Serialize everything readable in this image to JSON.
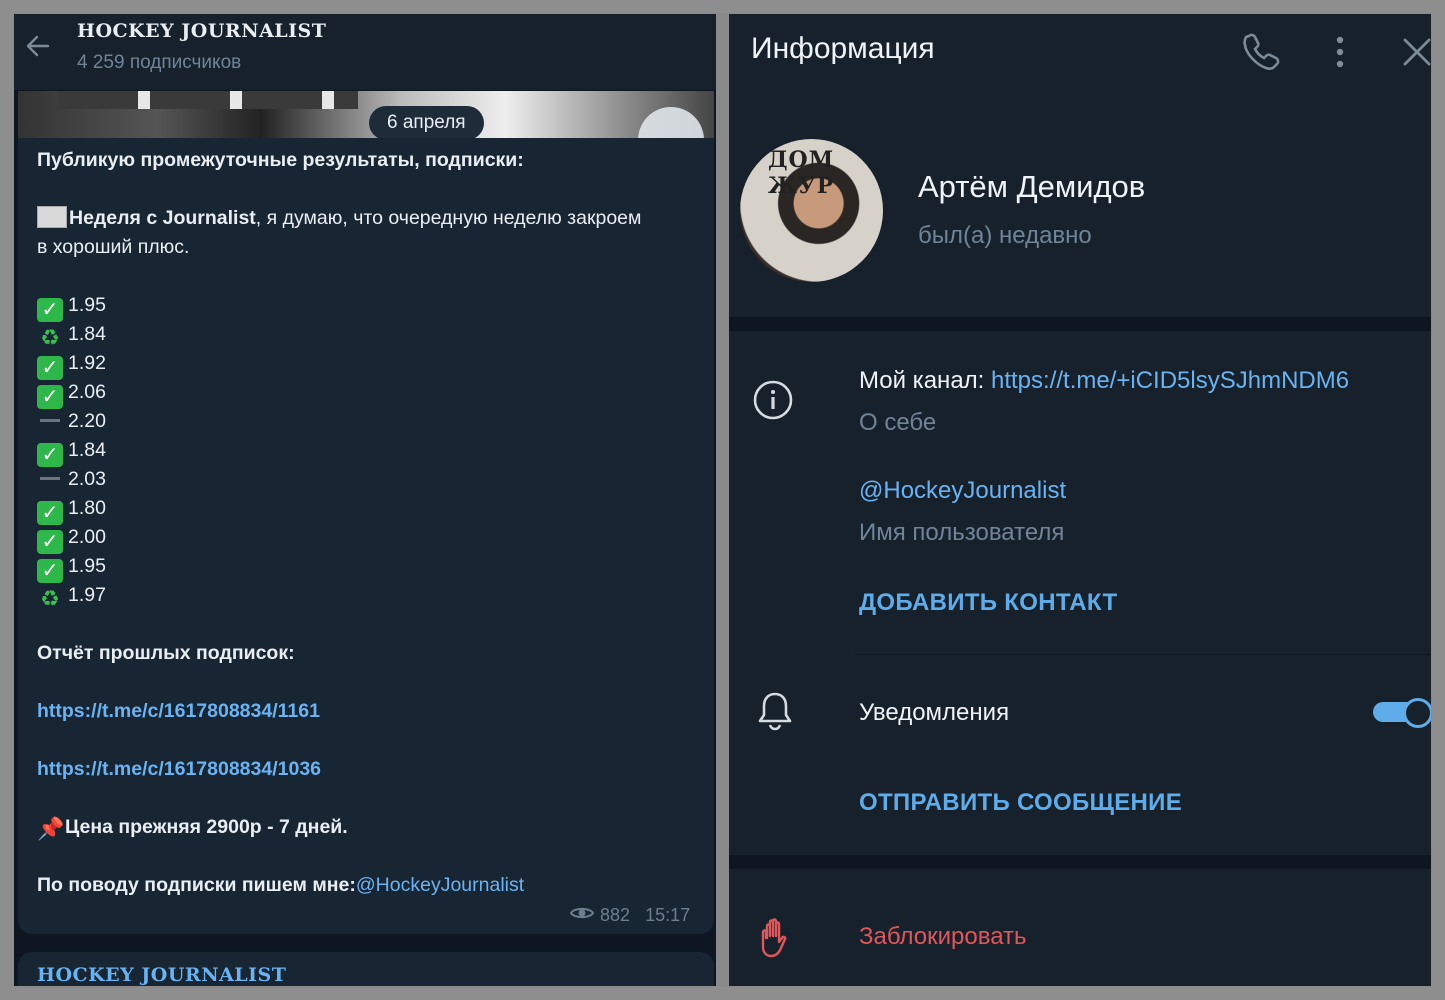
{
  "left_panel": {
    "header": {
      "channel_title": "HOCKEY JOURNALIST",
      "subscribers": "4 259 подписчиков"
    },
    "date_pill": "6 апреля",
    "message": {
      "intro": "Публикую промежуточные результаты, подписки:",
      "week_bold": "Неделя с Journalist",
      "week_rest": ", я думаю, что очередную неделю закроем",
      "week_rest2": "в хороший плюс.",
      "results": [
        {
          "icon": "check",
          "value": "1.95"
        },
        {
          "icon": "recycle",
          "value": "1.84"
        },
        {
          "icon": "check",
          "value": "1.92"
        },
        {
          "icon": "check",
          "value": "2.06"
        },
        {
          "icon": "dash",
          "value": "2.20"
        },
        {
          "icon": "check",
          "value": "1.84"
        },
        {
          "icon": "dash",
          "value": "2.03"
        },
        {
          "icon": "check",
          "value": "1.80"
        },
        {
          "icon": "check",
          "value": "2.00"
        },
        {
          "icon": "check",
          "value": "1.95"
        },
        {
          "icon": "recycle",
          "value": "1.97"
        }
      ],
      "report_label": "Отчёт прошлых подписок:",
      "link1": "https://t.me/c/1617808834/1161",
      "link2": "https://t.me/c/1617808834/1036",
      "price": "Цена прежняя 2900р - 7 дней.",
      "contact_prefix": "По поводу подписки пишем мне:",
      "contact_handle": "@HockeyJournalist",
      "views": "882",
      "time": "15:17"
    },
    "next_message_title": "HOCKEY JOURNALIST"
  },
  "right_panel": {
    "title": "Информация",
    "name": "Артём Демидов",
    "status": "был(а) недавно",
    "avatar_text": "ДОМ ЖУР",
    "channel_label": "Мой канал: ",
    "channel_link": "https://t.me/+iCID5lsySJhmNDM6",
    "bio_caption": "О себе",
    "username": "@HockeyJournalist",
    "username_caption": "Имя пользователя",
    "add_contact": "ДОБАВИТЬ КОНТАКТ",
    "notifications": "Уведомления",
    "notifications_on": true,
    "send_message": "ОТПРАВИТЬ СООБЩЕНИЕ",
    "block": "Заблокировать"
  },
  "colors": {
    "bg_dark": "#0e1621",
    "panel": "#17212b",
    "bubble": "#182533",
    "link": "#6ab3f3",
    "accent": "#5eacea",
    "danger": "#e0575b",
    "check_green": "#2fb84a"
  }
}
